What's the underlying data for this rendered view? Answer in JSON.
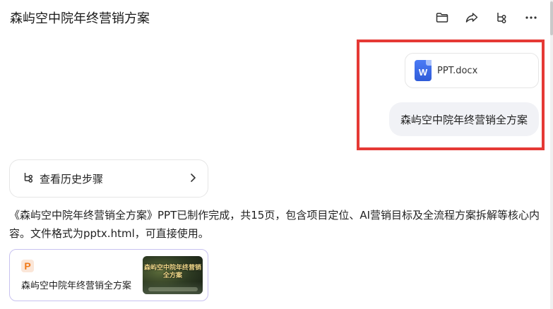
{
  "header": {
    "title": "森屿空中院年终营销方案",
    "actions": [
      {
        "icon": "folder-icon"
      },
      {
        "icon": "share-icon"
      },
      {
        "icon": "branch-icon"
      },
      {
        "icon": "more-icon"
      }
    ]
  },
  "user_message": {
    "attachment": {
      "icon": "word-doc-icon",
      "icon_letter": "W",
      "name": "PPT.docx"
    },
    "text": "森屿空中院年终营销全方案"
  },
  "history": {
    "label": "查看历史步骤"
  },
  "assistant_reply": {
    "text": "《森屿空中院年终营销全方案》PPT已制作完成，共15页，包含项目定位、AI营销目标及全流程方案拆解等核心内容。文件格式为pptx.html，可直接使用。"
  },
  "ppt_card": {
    "icon_letter": "P",
    "title": "森屿空中院年终营销全方案",
    "thumbnail_text": "森屿空中院年终营销全方案"
  },
  "colors": {
    "highlight": "#e53935",
    "word_blue": "#2f5bd8",
    "ppt_orange": "#f07a1a",
    "bubble_bg": "#f1f2f6",
    "card_border_purple": "#c8c2f0"
  }
}
